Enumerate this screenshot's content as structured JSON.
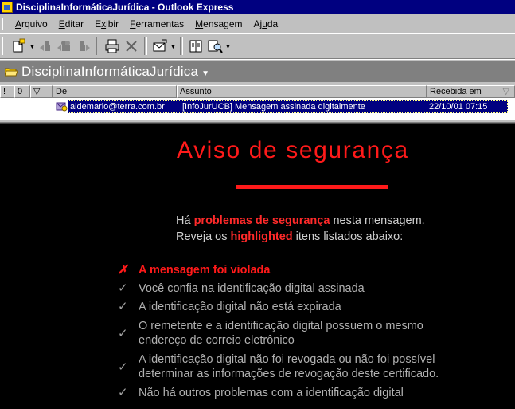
{
  "window": {
    "title": "DisciplinaInformáticaJurídica - Outlook Express"
  },
  "menu": [
    {
      "pre": "",
      "u": "A",
      "post": "rquivo"
    },
    {
      "pre": "",
      "u": "E",
      "post": "ditar"
    },
    {
      "pre": "E",
      "u": "x",
      "post": "ibir"
    },
    {
      "pre": "",
      "u": "F",
      "post": "erramentas"
    },
    {
      "pre": "",
      "u": "M",
      "post": "ensagem"
    },
    {
      "pre": "Aj",
      "u": "u",
      "post": "da"
    }
  ],
  "toolbar": {
    "icons": [
      "new-message-icon",
      "reply-icon",
      "reply-all-icon",
      "forward-icon",
      "print-icon",
      "delete-icon",
      "send-receive-icon",
      "addresses-icon",
      "find-icon"
    ]
  },
  "folder": {
    "name": "DisciplinaInformáticaJurídica"
  },
  "list": {
    "columns": {
      "flag": "!",
      "attach": "0",
      "watch": "▽",
      "from": "De",
      "subject": "Assunto",
      "received": "Recebida em"
    },
    "rows": [
      {
        "from": "aldemario@terra.com.br",
        "subject": "[InfoJurUCB] Mensagem assinada digitalmente",
        "received": "22/10/01 07:15"
      }
    ]
  },
  "preview": {
    "title": "Aviso de segurança",
    "intro": {
      "line1_pre": "Há ",
      "line1_highlight": "problemas de segurança",
      "line1_post": " nesta mensagem.",
      "line2_pre": "Reveja os ",
      "line2_highlight": "highlighted",
      "line2_post": " itens listados abaixo:"
    },
    "checks": {
      "item1": "A mensagem foi violada",
      "item2": "Você confia na identificação digital assinada",
      "item3": "A identificação digital não está expirada",
      "item4a": "O remetente e a identificação digital possuem o mesmo",
      "item4b": "endereço de correio eletrônico",
      "item5a": "A identificação digital não foi revogada ou não foi possível",
      "item5b": "determinar as informações de revogação deste certificado.",
      "item6": "Não há outros problemas com a identificação digital",
      "mark_fail": "✗",
      "mark_ok": "✓"
    }
  },
  "colors": {
    "titlebar": "#000080",
    "selection": "#000080",
    "alert_red": "#ff1a1a",
    "preview_bg": "#000000"
  }
}
